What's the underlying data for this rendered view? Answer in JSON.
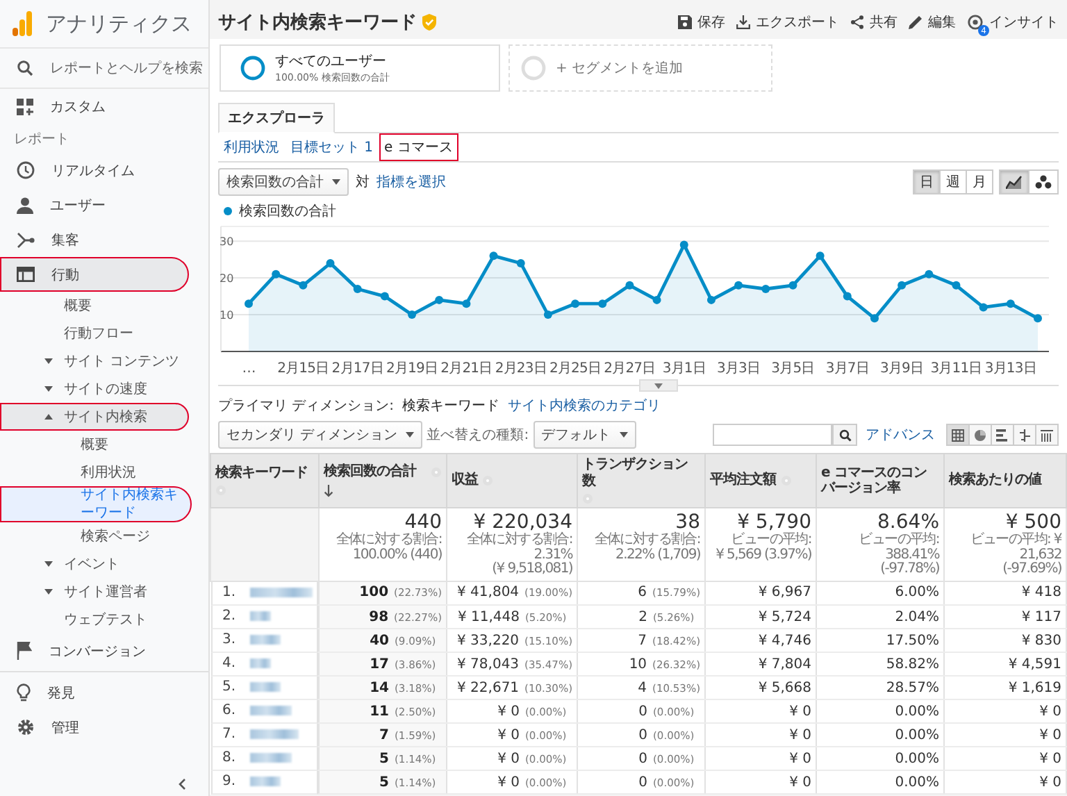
{
  "app": {
    "title": "アナリティクス"
  },
  "sidebar": {
    "search_placeholder": "レポートとヘルプを検索",
    "custom": "カスタム",
    "section_label": "レポート",
    "nav": [
      {
        "label": "リアルタイム",
        "expanded": false,
        "marked": false
      },
      {
        "label": "ユーザー",
        "expanded": false,
        "marked": false
      },
      {
        "label": "集客",
        "expanded": false,
        "marked": false
      },
      {
        "label": "行動",
        "expanded": true,
        "marked": true,
        "children": [
          {
            "kind": "leaf",
            "label": "概要",
            "selected": false,
            "marked": false
          },
          {
            "kind": "leaf",
            "label": "行動フロー",
            "selected": false,
            "marked": false
          },
          {
            "kind": "group",
            "label": "サイト コンテンツ",
            "expanded": false,
            "marked": false
          },
          {
            "kind": "group",
            "label": "サイトの速度",
            "expanded": false,
            "marked": false
          },
          {
            "kind": "group",
            "label": "サイト内検索",
            "expanded": true,
            "marked": true,
            "children": [
              {
                "label": "概要",
                "selected": false,
                "marked": false
              },
              {
                "label": "利用状況",
                "selected": false,
                "marked": false
              },
              {
                "label": "サイト内検索キーワード",
                "selected": true,
                "marked": true
              },
              {
                "label": "検索ページ",
                "selected": false,
                "marked": false
              }
            ]
          },
          {
            "kind": "group",
            "label": "イベント",
            "expanded": false,
            "marked": false
          },
          {
            "kind": "group",
            "label": "サイト運営者",
            "expanded": false,
            "marked": false
          },
          {
            "kind": "leaf",
            "label": "ウェブテスト",
            "selected": false,
            "marked": false
          }
        ]
      },
      {
        "label": "コンバージョン",
        "expanded": false,
        "marked": false
      }
    ],
    "footer": [
      {
        "label": "発見"
      },
      {
        "label": "管理"
      }
    ]
  },
  "header": {
    "title": "サイト内検索キーワード",
    "actions": [
      "保存",
      "エクスポート",
      "共有",
      "編集",
      "インサイト"
    ],
    "insight_badge": "4"
  },
  "segments": [
    {
      "name": "すべてのユーザー",
      "detail": "100.00% 検索回数の合計"
    }
  ],
  "add_segment": "+ セグメントを追加",
  "explorer_tab": "エクスプローラ",
  "subtabs": [
    {
      "label": "利用状況",
      "selected": false,
      "marked": false
    },
    {
      "label": "目標セット 1",
      "selected": false,
      "marked": false
    },
    {
      "label": "e コマース",
      "selected": true,
      "marked": true
    }
  ],
  "chart_controls": {
    "metric": "検索回数の合計",
    "versus": "対",
    "pick_metric": "指標を選択",
    "periods": [
      {
        "label": "日",
        "selected": true
      },
      {
        "label": "週",
        "selected": false
      },
      {
        "label": "月",
        "selected": false
      }
    ],
    "chart_types": [
      {
        "kind": "line",
        "selected": true
      },
      {
        "kind": "scatter",
        "selected": false
      }
    ]
  },
  "chart": {
    "chart_data": {
      "type": "area",
      "categories": [
        "…",
        null,
        "2月15日",
        null,
        "2月17日",
        null,
        "2月19日",
        null,
        "2月21日",
        null,
        "2月23日",
        null,
        "2月25日",
        null,
        "2月27日",
        null,
        "3月1日",
        null,
        "3月3日",
        null,
        "3月5日",
        null,
        "3月7日",
        null,
        "3月9日",
        null,
        "3月11日",
        null,
        "3月13日",
        null
      ],
      "series": [
        {
          "name": "検索回数の合計",
          "color": "#058dc7",
          "values": [
            13,
            21,
            18,
            24,
            17,
            15,
            10,
            14,
            13,
            26,
            24,
            10,
            13,
            13,
            18,
            14,
            29,
            14,
            18,
            17,
            18,
            26,
            15,
            9,
            18,
            21,
            18,
            12,
            13,
            9
          ]
        }
      ],
      "ylim": [
        0,
        34
      ],
      "yticks": [
        10,
        20,
        30
      ],
      "grid": true
    }
  },
  "dimension": {
    "label": "プライマリ ディメンション:",
    "current": "検索キーワード",
    "other": "サイト内検索のカテゴリ"
  },
  "toolbar": {
    "secondary": "セカンダリ ディメンション",
    "sort_label": "並べ替えの種類:",
    "sort": "デフォルト",
    "advanced": "アドバンス",
    "views": [
      {
        "kind": "table",
        "selected": true
      },
      {
        "kind": "pie",
        "selected": false
      },
      {
        "kind": "bars",
        "selected": false
      },
      {
        "kind": "compare",
        "selected": false
      },
      {
        "kind": "pivot",
        "selected": false
      }
    ]
  },
  "table": {
    "columns": [
      {
        "label": "検索キーワード",
        "help": true,
        "sorted": false
      },
      {
        "label": "検索回数の合計",
        "help": true,
        "sorted": true
      },
      {
        "label": "収益",
        "help": true,
        "sorted": false
      },
      {
        "label": "トランザクション数",
        "help": true,
        "sorted": false
      },
      {
        "label": "平均注文額",
        "help": true,
        "sorted": false
      },
      {
        "label": "e コマースのコンバージョン率",
        "help": false,
        "sorted": false
      },
      {
        "label": "検索あたりの値",
        "help": false,
        "sorted": false
      }
    ],
    "totals": [
      {
        "value": "440",
        "note": [
          "全体に対する割合:",
          "100.00% (440)"
        ]
      },
      {
        "value": "¥ 220,034",
        "note": [
          "全体に対する割合: 2.31%",
          "(¥ 9,518,081)"
        ]
      },
      {
        "value": "38",
        "note": [
          "全体に対する割合:",
          "2.22% (1,709)"
        ]
      },
      {
        "value": "¥ 5,790",
        "note": [
          "ビューの平均:",
          "¥ 5,569 (3.97%)"
        ]
      },
      {
        "value": "8.64%",
        "note": [
          "ビューの平均: 388.41%",
          "(-97.78%)"
        ]
      },
      {
        "value": "¥ 500",
        "note": [
          "ビューの平均: ¥ 21,632",
          "(-97.69%)"
        ]
      }
    ],
    "rows": [
      {
        "index": "1.",
        "searches": "100",
        "searches_pct": "(22.73%)",
        "revenue": "¥ 41,804",
        "revenue_pct": "(19.00%)",
        "transactions": "6",
        "transactions_pct": "(15.79%)",
        "avg_order": "¥ 6,967",
        "conversion": "6.00%",
        "per_search": "¥ 418"
      },
      {
        "index": "2.",
        "searches": "98",
        "searches_pct": "(22.27%)",
        "revenue": "¥ 11,448",
        "revenue_pct": "(5.20%)",
        "transactions": "2",
        "transactions_pct": "(5.26%)",
        "avg_order": "¥ 5,724",
        "conversion": "2.04%",
        "per_search": "¥ 117"
      },
      {
        "index": "3.",
        "searches": "40",
        "searches_pct": "(9.09%)",
        "revenue": "¥ 33,220",
        "revenue_pct": "(15.10%)",
        "transactions": "7",
        "transactions_pct": "(18.42%)",
        "avg_order": "¥ 4,746",
        "conversion": "17.50%",
        "per_search": "¥ 830"
      },
      {
        "index": "4.",
        "searches": "17",
        "searches_pct": "(3.86%)",
        "revenue": "¥ 78,043",
        "revenue_pct": "(35.47%)",
        "transactions": "10",
        "transactions_pct": "(26.32%)",
        "avg_order": "¥ 7,804",
        "conversion": "58.82%",
        "per_search": "¥ 4,591"
      },
      {
        "index": "5.",
        "searches": "14",
        "searches_pct": "(3.18%)",
        "revenue": "¥ 22,671",
        "revenue_pct": "(10.30%)",
        "transactions": "4",
        "transactions_pct": "(10.53%)",
        "avg_order": "¥ 5,668",
        "conversion": "28.57%",
        "per_search": "¥ 1,619"
      },
      {
        "index": "6.",
        "searches": "11",
        "searches_pct": "(2.50%)",
        "revenue": "¥ 0",
        "revenue_pct": "(0.00%)",
        "transactions": "0",
        "transactions_pct": "(0.00%)",
        "avg_order": "¥ 0",
        "conversion": "0.00%",
        "per_search": "¥ 0"
      },
      {
        "index": "7.",
        "searches": "7",
        "searches_pct": "(1.59%)",
        "revenue": "¥ 0",
        "revenue_pct": "(0.00%)",
        "transactions": "0",
        "transactions_pct": "(0.00%)",
        "avg_order": "¥ 0",
        "conversion": "0.00%",
        "per_search": "¥ 0"
      },
      {
        "index": "8.",
        "searches": "5",
        "searches_pct": "(1.14%)",
        "revenue": "¥ 0",
        "revenue_pct": "(0.00%)",
        "transactions": "0",
        "transactions_pct": "(0.00%)",
        "avg_order": "¥ 0",
        "conversion": "0.00%",
        "per_search": "¥ 0"
      },
      {
        "index": "9.",
        "searches": "5",
        "searches_pct": "(1.14%)",
        "revenue": "¥ 0",
        "revenue_pct": "(0.00%)",
        "transactions": "0",
        "transactions_pct": "(0.00%)",
        "avg_order": "¥ 0",
        "conversion": "0.00%",
        "per_search": "¥ 0"
      }
    ]
  }
}
